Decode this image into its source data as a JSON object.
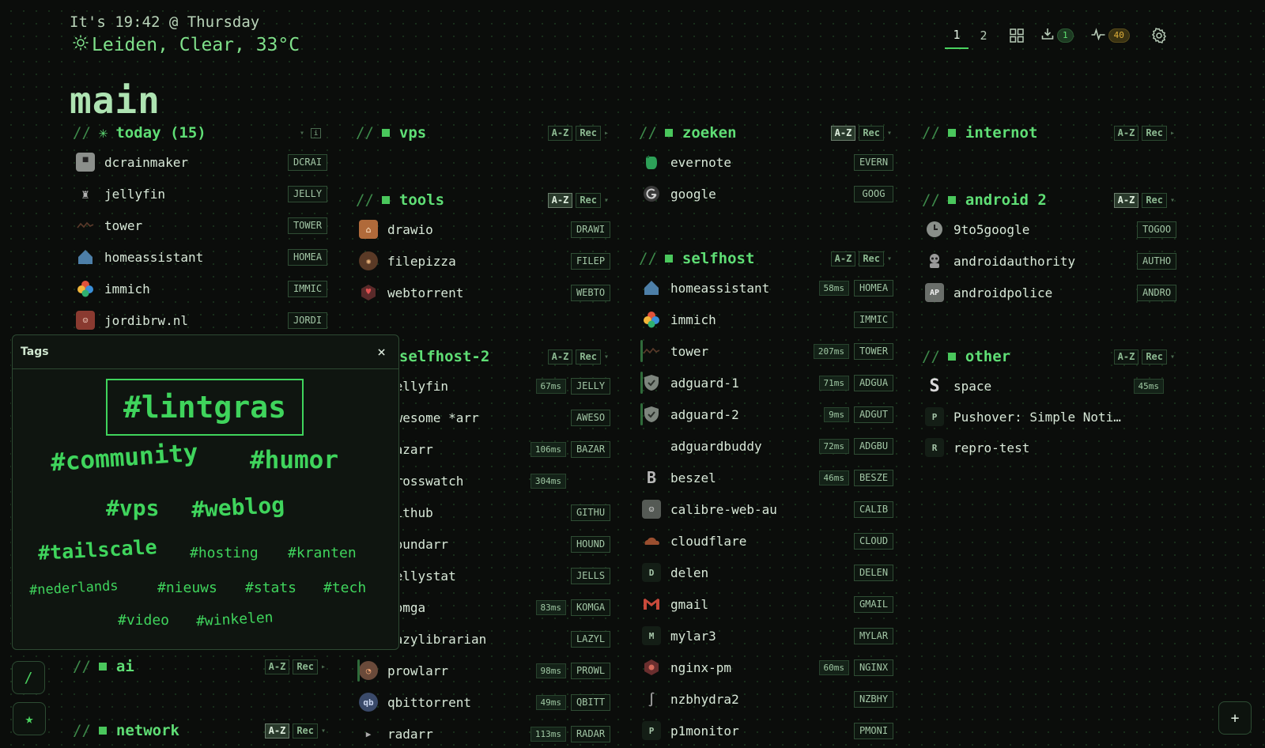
{
  "header": {
    "clock": "It's 19:42 @ Thursday",
    "weather": "Leiden, Clear, 33°C",
    "title": "main"
  },
  "topnav": {
    "ws1": "1",
    "ws2": "2",
    "downloads_count": "1",
    "activity_count": "40"
  },
  "colors": {
    "accent": "#4ad35f",
    "background": "#0b0d0b"
  },
  "sections": {
    "today": {
      "title": "today (15)",
      "items": [
        {
          "name": "dcrainmaker",
          "key": "DCRAI"
        },
        {
          "name": "jellyfin",
          "key": "JELLY"
        },
        {
          "name": "tower",
          "key": "TOWER"
        },
        {
          "name": "homeassistant",
          "key": "HOMEA"
        },
        {
          "name": "immich",
          "key": "IMMIC"
        },
        {
          "name": "jordibrw.nl",
          "key": "JORDI"
        }
      ]
    },
    "ai": {
      "title": "ai"
    },
    "network": {
      "title": "network"
    },
    "vps": {
      "title": "vps"
    },
    "tools": {
      "title": "tools",
      "items": [
        {
          "name": "drawio",
          "key": "DRAWI"
        },
        {
          "name": "filepizza",
          "key": "FILEP"
        },
        {
          "name": "webtorrent",
          "key": "WEBTO"
        }
      ]
    },
    "selfhost2": {
      "title": "selfhost-2",
      "items": [
        {
          "name": "jellyfin",
          "lat": "67ms",
          "key": "JELLY"
        },
        {
          "name": "awesome *arr",
          "key": "AWESO"
        },
        {
          "name": "bazarr",
          "lat": "106ms",
          "key": "BAZAR"
        },
        {
          "name": "crosswatch",
          "lat": "304ms",
          "key": ""
        },
        {
          "name": "github",
          "key": "GITHU"
        },
        {
          "name": "houndarr",
          "key": "HOUND"
        },
        {
          "name": "jellystat",
          "key": "JELLS"
        },
        {
          "name": "komga",
          "lat": "83ms",
          "key": "KOMGA"
        },
        {
          "name": "lazylibrarian",
          "key": "LAZYL"
        },
        {
          "name": "prowlarr",
          "lat": "98ms",
          "key": "PROWL"
        },
        {
          "name": "qbittorrent",
          "lat": "49ms",
          "key": "QBITT"
        },
        {
          "name": "radarr",
          "lat": "113ms",
          "key": "RADAR"
        }
      ]
    },
    "zoeken": {
      "title": "zoeken",
      "items": [
        {
          "name": "evernote",
          "key": "EVERN"
        },
        {
          "name": "google",
          "key": "GOOG"
        }
      ]
    },
    "selfhost": {
      "title": "selfhost",
      "items": [
        {
          "name": "homeassistant",
          "lat": "58ms",
          "key": "HOMEA"
        },
        {
          "name": "immich",
          "key": "IMMIC"
        },
        {
          "name": "tower",
          "lat": "207ms",
          "key": "TOWER"
        },
        {
          "name": "adguard-1",
          "lat": "71ms",
          "key": "ADGUA"
        },
        {
          "name": "adguard-2",
          "lat": "9ms",
          "key": "ADGUT"
        },
        {
          "name": "adguardbuddy",
          "lat": "72ms",
          "key": "ADGBU"
        },
        {
          "name": "beszel",
          "lat": "46ms",
          "key": "BESZE"
        },
        {
          "name": "calibre-web-au",
          "key": "CALIB"
        },
        {
          "name": "cloudflare",
          "key": "CLOUD"
        },
        {
          "name": "delen",
          "key": "DELEN"
        },
        {
          "name": "gmail",
          "key": "GMAIL"
        },
        {
          "name": "mylar3",
          "key": "MYLAR"
        },
        {
          "name": "nginx-pm",
          "lat": "60ms",
          "key": "NGINX"
        },
        {
          "name": "nzbhydra2",
          "key": "NZBHY"
        },
        {
          "name": "p1monitor",
          "key": "PMONI"
        }
      ]
    },
    "internot": {
      "title": "internot"
    },
    "android2": {
      "title": "android 2",
      "items": [
        {
          "name": "9to5google",
          "key": "TOGOO"
        },
        {
          "name": "androidauthority",
          "key": "AUTHO"
        },
        {
          "name": "androidpolice",
          "key": "ANDRO"
        }
      ]
    },
    "other": {
      "title": "other",
      "items": [
        {
          "name": "space",
          "lat": "45ms",
          "key": ""
        },
        {
          "name": "Pushover: Simple Noti…",
          "key": ""
        },
        {
          "name": "repro-test",
          "key": ""
        }
      ]
    }
  },
  "buttons": {
    "az": "A-Z",
    "rec": "Rec"
  },
  "tags": {
    "title": "Tags",
    "close": "×",
    "list": [
      "#lintgras",
      "#community",
      "#humor",
      "#vps",
      "#weblog",
      "#tailscale",
      "#hosting",
      "#kranten",
      "#nederlands",
      "#nieuws",
      "#stats",
      "#tech",
      "#video",
      "#winkelen"
    ]
  },
  "side": {
    "search": "/",
    "fav": "★",
    "add": "+"
  }
}
